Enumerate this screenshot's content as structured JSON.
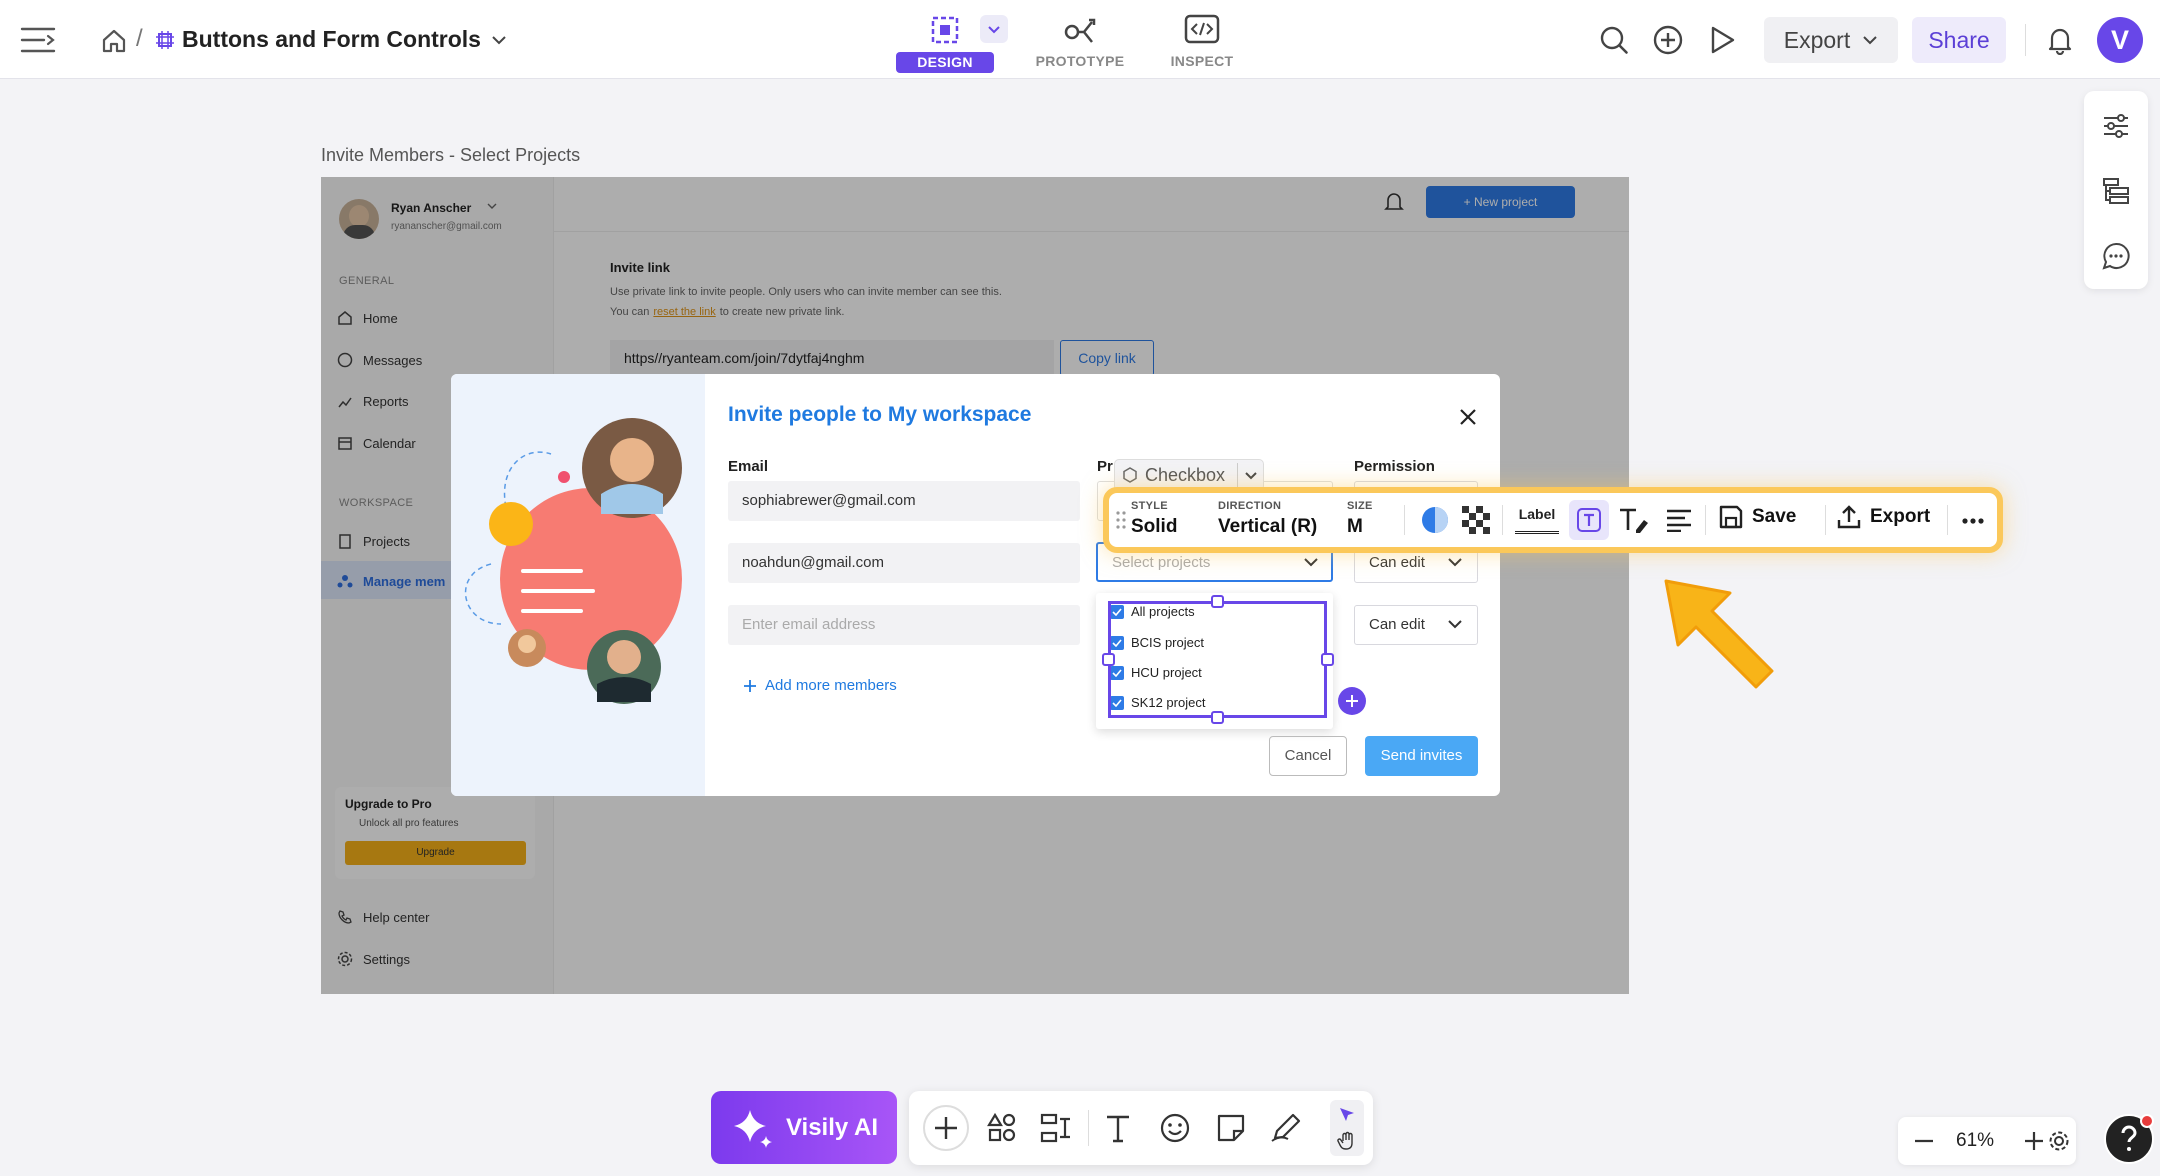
{
  "topbar": {
    "breadcrumb_sep": "/",
    "doc_title": "Buttons and Form Controls",
    "tabs": [
      {
        "label": "DESIGN",
        "active": true
      },
      {
        "label": "PROTOTYPE",
        "active": false
      },
      {
        "label": "INSPECT",
        "active": false
      }
    ],
    "export_label": "Export",
    "share_label": "Share",
    "avatar_letter": "V",
    "accent": "#6847e8"
  },
  "frame": {
    "title": "Invite Members - Select Projects",
    "user_name": "Ryan Anscher",
    "user_email": "ryananscher@gmail.com",
    "new_project": "+ New project",
    "general_label": "GENERAL",
    "general_items": [
      "Home",
      "Messages",
      "Reports",
      "Calendar"
    ],
    "workspace_label": "WORKSPACE",
    "workspace_items": [
      "Projects",
      "Manage mem"
    ],
    "invite_link_title": "Invite link",
    "invite_text_1": "Use private link to invite people. Only users who can invite member can see this.",
    "invite_text_2a": "You can",
    "invite_text_2_link": "reset the link",
    "invite_text_2b": "to create new private link.",
    "link_url": "https//ryanteam.com/join/7dytfaj4nghm",
    "copy_link": "Copy link",
    "upgrade_title": "Upgrade to Pro",
    "upgrade_sub": "Unlock all pro features",
    "upgrade_btn": "Upgrade",
    "help_center": "Help center",
    "settings": "Settings"
  },
  "modal": {
    "title": "Invite people to My workspace",
    "email_label": "Email",
    "projects_label_partial": "Pr",
    "permission_label": "Permission",
    "emails": [
      "sophiabrewer@gmail.com",
      "noahdun@gmail.com"
    ],
    "email_placeholder": "Enter email address",
    "add_more": "Add more members",
    "select_placeholder": "Select projects",
    "permissions": [
      "Can edit",
      "Can edit"
    ],
    "checkbox_items": [
      "All projects",
      "BCIS project",
      "HCU project",
      "SK12 project"
    ],
    "cancel": "Cancel",
    "send": "Send invites",
    "component_tag": "Checkbox"
  },
  "floating_toolbar": {
    "style_label": "STYLE",
    "style_value": "Solid",
    "direction_label": "DIRECTION",
    "direction_value": "Vertical (R)",
    "size_label": "SIZE",
    "size_value": "M",
    "label_btn": "Label",
    "save": "Save",
    "export": "Export"
  },
  "bottom": {
    "ai_label": "Visily AI",
    "zoom": "61%"
  }
}
